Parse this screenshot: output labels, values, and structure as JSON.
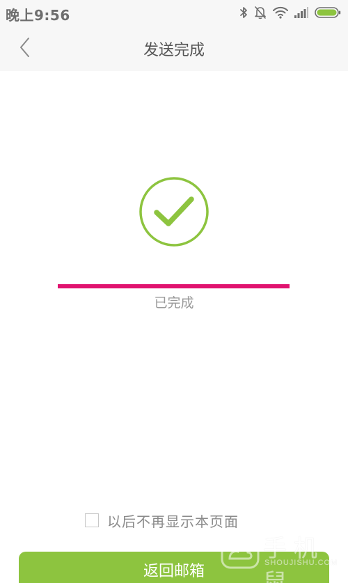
{
  "status_bar": {
    "time": "晚上9:56",
    "icons": [
      "bluetooth-icon",
      "notifications-muted-icon",
      "wifi-icon",
      "cellular-signal-icon",
      "battery-icon"
    ],
    "battery_color": "#8dc43f"
  },
  "nav": {
    "back_icon": "chevron-left-icon",
    "title": "发送完成"
  },
  "result": {
    "icon": "check-circle-icon",
    "icon_color": "#8dc43f",
    "progress_fraction": 1.0,
    "progress_color": "#e0136f",
    "status_label": "已完成"
  },
  "footer": {
    "dont_show_checked": false,
    "dont_show_label": "以后不再显示本页面",
    "return_button_label": "返回邮箱",
    "button_color": "#8dc43f"
  },
  "watermark": {
    "brand": "手机鼠",
    "url": "SHOUJISHU.COM"
  }
}
